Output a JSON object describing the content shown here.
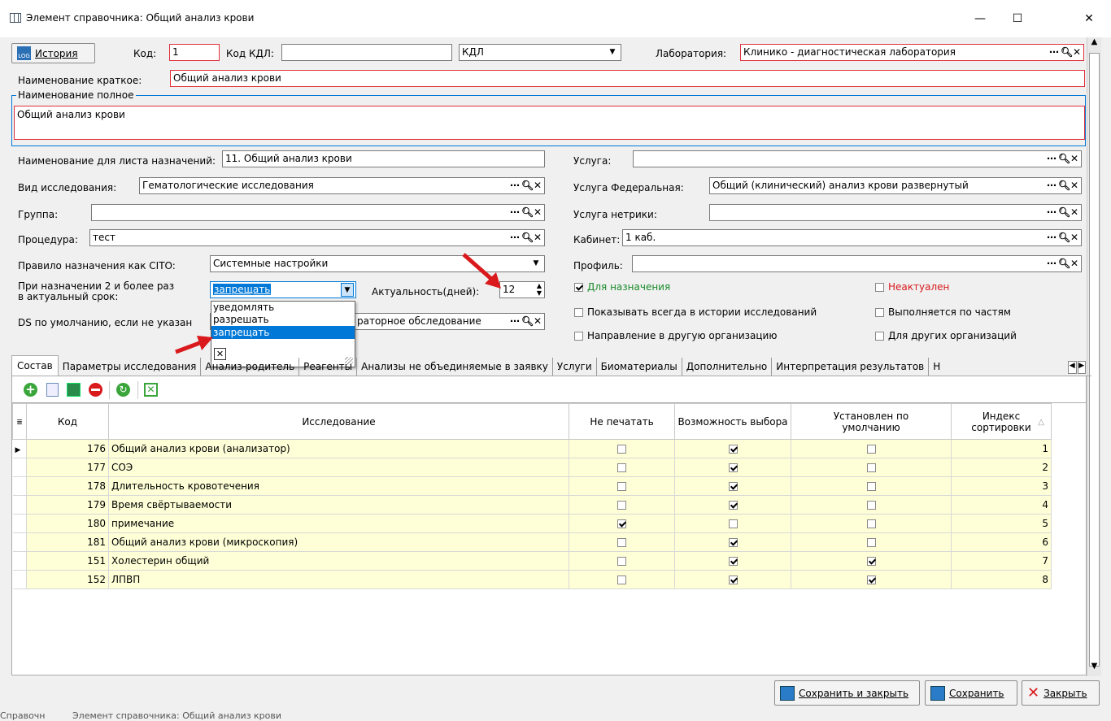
{
  "window": {
    "title": "Элемент справочника: Общий анализ крови"
  },
  "header": {
    "history_btn": "История",
    "kod_label": "Код:",
    "kod_value": "1",
    "kod_kdl_label": "Код КДЛ:",
    "kod_kdl_value": "",
    "kdl_select": "КДЛ",
    "lab_label": "Лаборатория:",
    "lab_value": "Клинико - диагностическая лаборатория",
    "short_name_label": "Наименование краткое:",
    "short_name_value": "Общий анализ крови",
    "full_name_legend": "Наименование полное",
    "full_name_value": "Общий анализ крови"
  },
  "left": {
    "list_name_label": "Наименование для листа назначений:",
    "list_name_value": "11. Общий анализ крови",
    "vid_label": "Вид исследования:",
    "vid_value": "Гематологические исследования",
    "group_label": "Группа:",
    "group_value": "",
    "proc_label": "Процедура:",
    "proc_value": "тест",
    "cito_label": "Правило назначения как CITO:",
    "cito_value": "Системные настройки",
    "repeat_label1": "При назначении 2 и более раз",
    "repeat_label2": "в актуальный срок:",
    "repeat_value": "запрещать",
    "actual_label": "Актуальность(дней):",
    "actual_value": "12",
    "ds_label": "DS по умолчанию, если не указан",
    "ds_value": "раторное обследование",
    "dropdown_options": [
      "уведомлять",
      "разрешать",
      "запрещать"
    ]
  },
  "right": {
    "usluga_label": "Услуга:",
    "usluga_value": "",
    "usluga_fed_label": "Услуга Федеральная:",
    "usluga_fed_value": "Общий (клинический) анализ крови развернутый",
    "usluga_netr_label": "Услуга нетрики:",
    "usluga_netr_value": "",
    "cabinet_label": "Кабинет:",
    "cabinet_value": "1 каб.",
    "profile_label": "Профиль:",
    "profile_value": "",
    "cb_naznach": "Для назначения",
    "cb_neaktual": "Неактуален",
    "cb_show_always": "Показывать всегда в истории исследований",
    "cb_parts": "Выполняется по частям",
    "cb_direction": "Направление в другую организацию",
    "cb_other_orgs": "Для других организаций"
  },
  "tabs": [
    "Состав",
    "Параметры исследования",
    "Анализ-родитель",
    "Реагенты",
    "Анализы не объединяемые в заявку",
    "Услуги",
    "Биоматериалы",
    "Дополнительно",
    "Интерпретация результатов",
    "Н"
  ],
  "table": {
    "headers": {
      "code": "Код",
      "research": "Исследование",
      "no_print": "Не печатать",
      "choice": "Возможность выбора",
      "default1": "Установлен по",
      "default2": "умолчанию",
      "index1": "Индекс",
      "index2": "сортировки"
    },
    "rows": [
      {
        "code": "176",
        "name": "Общий анализ крови (анализатор)",
        "no_print": false,
        "choice": true,
        "default": false,
        "index": "1"
      },
      {
        "code": "177",
        "name": "СОЭ",
        "no_print": false,
        "choice": true,
        "default": false,
        "index": "2"
      },
      {
        "code": "178",
        "name": "Длительность кровотечения",
        "no_print": false,
        "choice": true,
        "default": false,
        "index": "3"
      },
      {
        "code": "179",
        "name": "Время свёртываемости",
        "no_print": false,
        "choice": true,
        "default": false,
        "index": "4"
      },
      {
        "code": "180",
        "name": "примечание",
        "no_print": true,
        "choice": false,
        "default": false,
        "index": "5"
      },
      {
        "code": "181",
        "name": "Общий анализ крови (микроскопия)",
        "no_print": false,
        "choice": true,
        "default": false,
        "index": "6"
      },
      {
        "code": "151",
        "name": "Холестерин общий",
        "no_print": false,
        "choice": true,
        "default": true,
        "index": "7"
      },
      {
        "code": "152",
        "name": "ЛПВП",
        "no_print": false,
        "choice": true,
        "default": true,
        "index": "8"
      }
    ]
  },
  "footer": {
    "save_close": "Сохранить и закрыть",
    "save": "Сохранить",
    "close": "Закрыть"
  },
  "taskbar": {
    "item1": "Справочн",
    "item2": "Элемент справочника: Общий анализ крови"
  },
  "colors": {
    "accent": "#0078d7",
    "required_border": "#e0303a",
    "row_bg": "#ffffd7",
    "arrow": "#d9191c"
  }
}
